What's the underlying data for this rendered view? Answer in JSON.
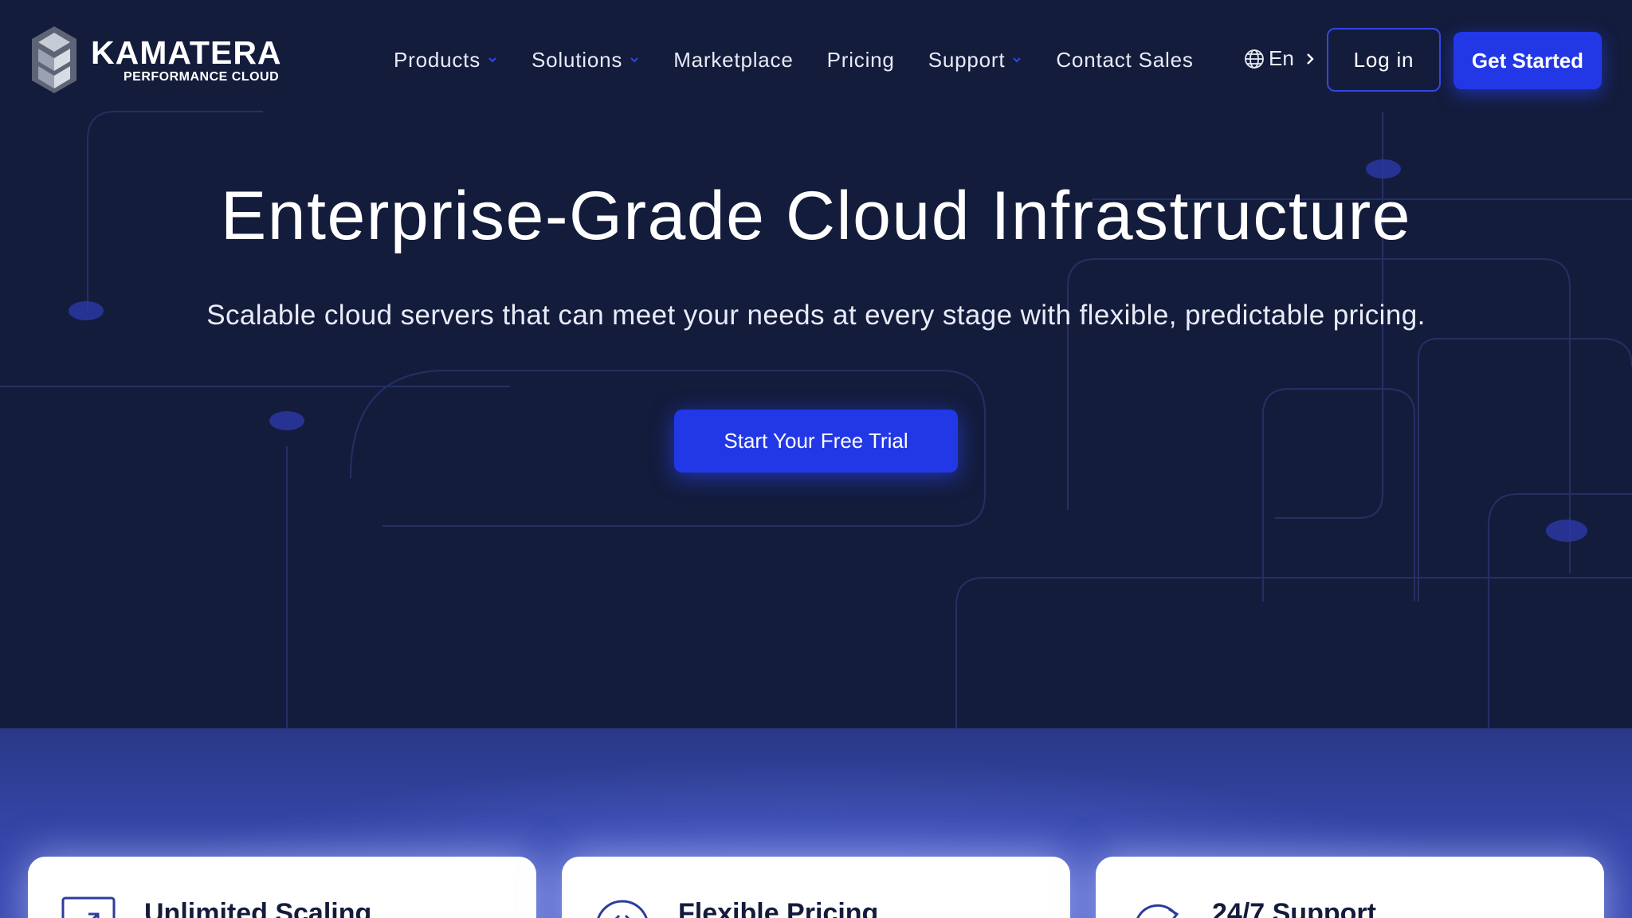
{
  "brand": {
    "name": "KAMATERA",
    "tagline": "PERFORMANCE CLOUD"
  },
  "nav": {
    "items": [
      {
        "label": "Products",
        "has_dropdown": true
      },
      {
        "label": "Solutions",
        "has_dropdown": true
      },
      {
        "label": "Marketplace",
        "has_dropdown": false
      },
      {
        "label": "Pricing",
        "has_dropdown": false
      },
      {
        "label": "Support",
        "has_dropdown": true
      },
      {
        "label": "Contact Sales",
        "has_dropdown": false
      }
    ],
    "language": "En",
    "login_label": "Log in",
    "get_started_label": "Get Started"
  },
  "hero": {
    "title": "Enterprise-Grade Cloud Infrastructure",
    "subtitle": "Scalable cloud servers that can meet your needs at every stage with flexible, predictable pricing.",
    "cta_label": "Start Your Free Trial"
  },
  "features": [
    {
      "title": "Unlimited Scaling",
      "icon": "scaling-icon"
    },
    {
      "title": "Flexible Pricing",
      "icon": "pricing-icon"
    },
    {
      "title": "24/7 Support",
      "icon": "support-icon"
    }
  ],
  "colors": {
    "background": "#141c3c",
    "accent": "#2238e6",
    "card": "#ffffff",
    "glow": "#3445a8"
  }
}
